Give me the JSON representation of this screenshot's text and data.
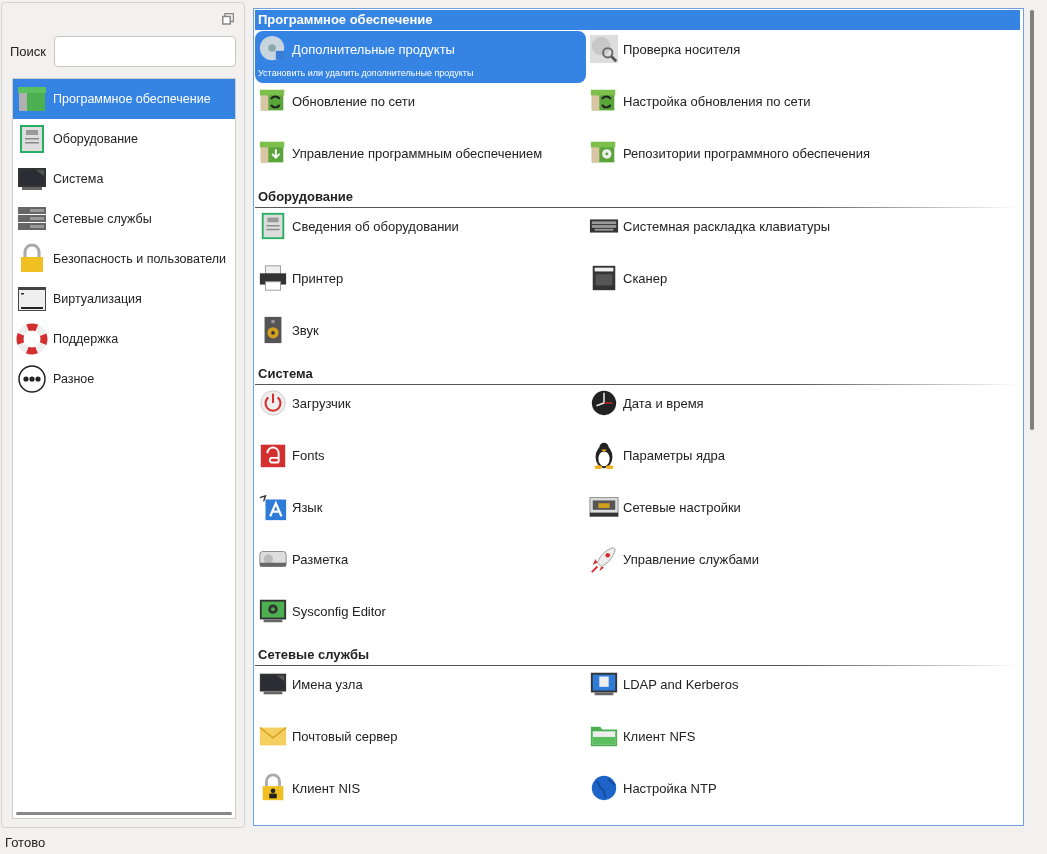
{
  "search": {
    "label": "Поиск"
  },
  "categories": [
    {
      "label": "Программное обеспечение",
      "selected": true
    },
    {
      "label": "Оборудование",
      "selected": false
    },
    {
      "label": "Система",
      "selected": false
    },
    {
      "label": "Сетевые службы",
      "selected": false
    },
    {
      "label": "Безопасность и пользователи",
      "selected": false
    },
    {
      "label": "Виртуализация",
      "selected": false
    },
    {
      "label": "Поддержка",
      "selected": false
    },
    {
      "label": "Разное",
      "selected": false
    }
  ],
  "sections": [
    {
      "title": "Программное обеспечение",
      "selected": true,
      "items": [
        {
          "label": "Дополнительные продукты",
          "description": "Установить или удалить дополнительные продукты",
          "selected": true
        },
        {
          "label": "Проверка носителя",
          "selected": false
        },
        {
          "label": "Обновление по сети",
          "selected": false
        },
        {
          "label": "Настройка обновления по сети",
          "selected": false
        },
        {
          "label": "Управление программным обеспечением",
          "selected": false
        },
        {
          "label": "Репозитории программного обеспечения",
          "selected": false
        }
      ]
    },
    {
      "title": "Оборудование",
      "selected": false,
      "items": [
        {
          "label": "Сведения об оборудовании",
          "selected": false
        },
        {
          "label": "Системная раскладка клавиатуры",
          "selected": false
        },
        {
          "label": "Принтер",
          "selected": false
        },
        {
          "label": "Сканер",
          "selected": false
        },
        {
          "label": "Звук",
          "selected": false
        }
      ]
    },
    {
      "title": "Система",
      "selected": false,
      "items": [
        {
          "label": "Загрузчик",
          "selected": false
        },
        {
          "label": "Дата и время",
          "selected": false
        },
        {
          "label": "Fonts",
          "selected": false
        },
        {
          "label": "Параметры ядра",
          "selected": false
        },
        {
          "label": "Язык",
          "selected": false
        },
        {
          "label": "Сетевые настройки",
          "selected": false
        },
        {
          "label": "Разметка",
          "selected": false
        },
        {
          "label": "Управление службами",
          "selected": false
        },
        {
          "label": "Sysconfig Editor",
          "selected": false
        }
      ]
    },
    {
      "title": "Сетевые службы",
      "selected": false,
      "items": [
        {
          "label": "Имена узла",
          "selected": false
        },
        {
          "label": "LDAP and Kerberos",
          "selected": false
        },
        {
          "label": "Почтовый сервер",
          "selected": false
        },
        {
          "label": "Клиент NFS",
          "selected": false
        },
        {
          "label": "Клиент NIS",
          "selected": false
        },
        {
          "label": "Настройка NTP",
          "selected": false
        }
      ]
    }
  ],
  "status_bar": "Готово"
}
